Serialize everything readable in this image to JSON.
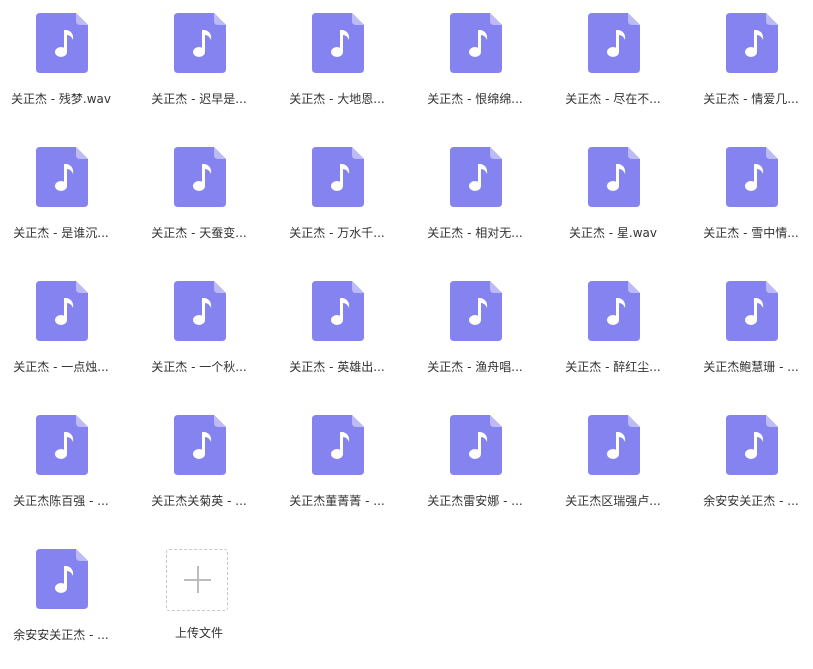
{
  "files": [
    {
      "label": "关正杰 - 残梦.wav"
    },
    {
      "label": "关正杰 - 迟早是..."
    },
    {
      "label": "关正杰 - 大地恩..."
    },
    {
      "label": "关正杰 - 恨绵绵..."
    },
    {
      "label": "关正杰 - 尽在不..."
    },
    {
      "label": "关正杰 - 情爱几..."
    },
    {
      "label": "关正杰 - 是谁沉..."
    },
    {
      "label": "关正杰 - 天蚕变..."
    },
    {
      "label": "关正杰 - 万水千..."
    },
    {
      "label": "关正杰 - 相对无..."
    },
    {
      "label": "关正杰 - 星.wav"
    },
    {
      "label": "关正杰 - 雪中情..."
    },
    {
      "label": "关正杰 - 一点烛..."
    },
    {
      "label": "关正杰 - 一个秋..."
    },
    {
      "label": "关正杰 - 英雄出..."
    },
    {
      "label": "关正杰 - 渔舟唱..."
    },
    {
      "label": "关正杰 - 醉红尘..."
    },
    {
      "label": "关正杰鲍慧珊 - ..."
    },
    {
      "label": "关正杰陈百强 - ..."
    },
    {
      "label": "关正杰关菊英 - ..."
    },
    {
      "label": "关正杰董菁菁 - ..."
    },
    {
      "label": "关正杰雷安娜 - ..."
    },
    {
      "label": "关正杰区瑞强卢..."
    },
    {
      "label": "余安安关正杰 - ..."
    },
    {
      "label": "余安安关正杰 - ..."
    }
  ],
  "upload": {
    "label": "上传文件",
    "icon": "plus-icon"
  },
  "file_icon": {
    "name": "music-file-icon",
    "color": "#8583ef",
    "fold_color": "#bcbaf7"
  }
}
